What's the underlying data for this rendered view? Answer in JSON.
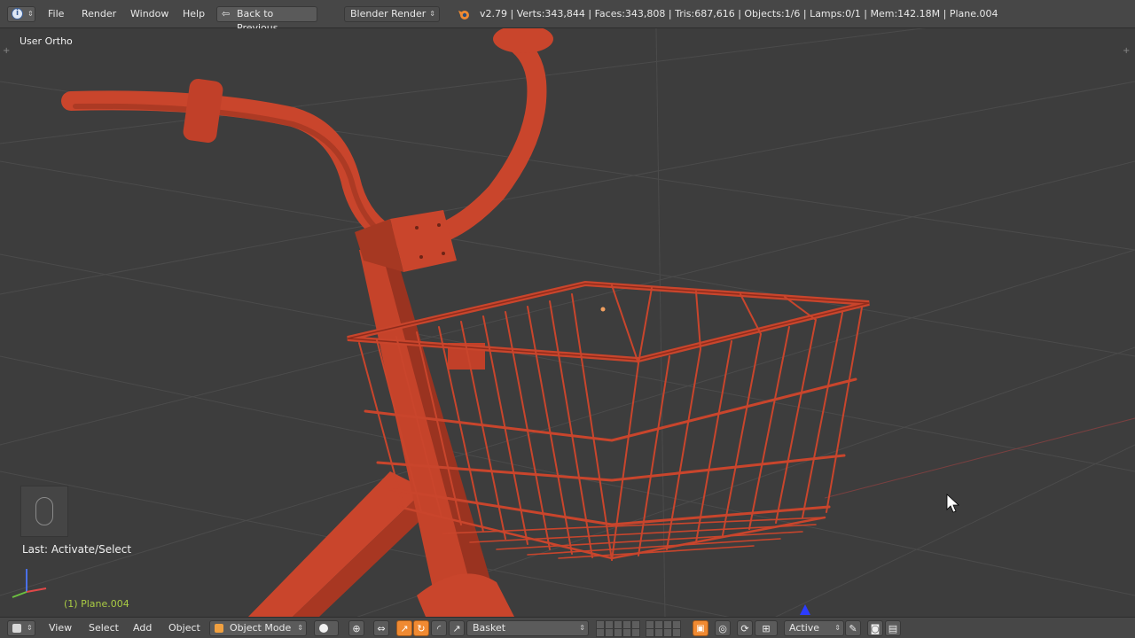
{
  "menu": {
    "file": "File",
    "render": "Render",
    "window": "Window",
    "help": "Help"
  },
  "back_button": "Back to Previous",
  "render_engine": "Blender Render",
  "stats": "v2.79 | Verts:343,844 | Faces:343,808 | Tris:687,616 | Objects:1/6 | Lamps:0/1 | Mem:142.18M | Plane.004",
  "viewport": {
    "view_label": "User Ortho",
    "last_operator": "Last: Activate/Select",
    "object_label": "(1) Plane.004"
  },
  "header": {
    "view": "View",
    "select": "Select",
    "add": "Add",
    "object": "Object",
    "mode": "Object Mode",
    "layer_name": "Basket",
    "pivot_value": "Active"
  },
  "colors": {
    "model": "#c9452c",
    "model_dark": "#8f2c1c",
    "grid": "#4b4b4b",
    "accent": "#f08a32",
    "object_label": "#aacc44"
  }
}
